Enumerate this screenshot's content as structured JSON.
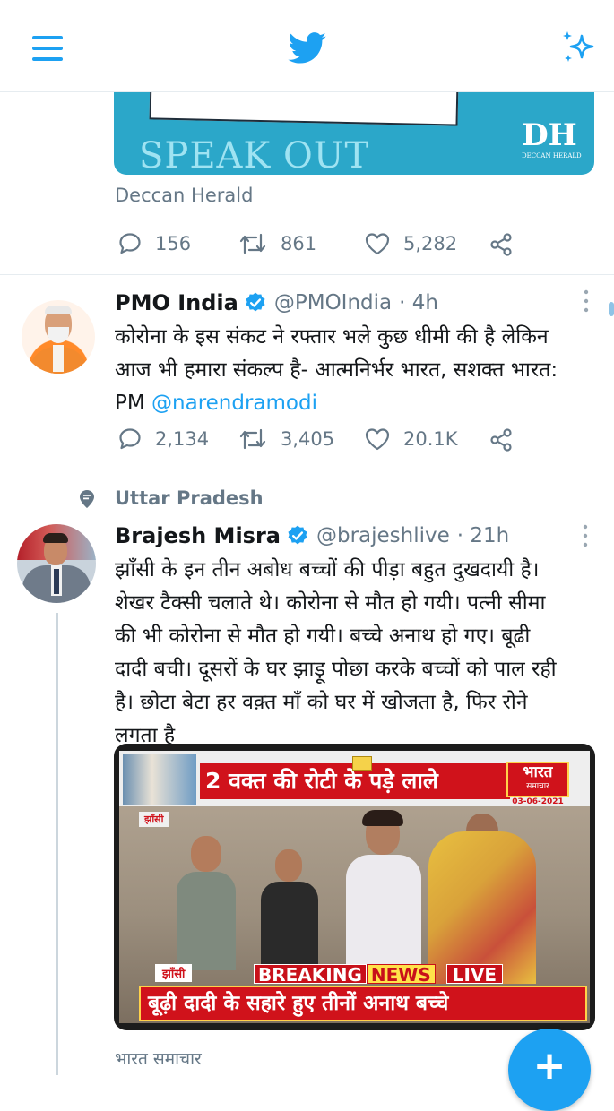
{
  "header": {
    "menu_icon": "hamburger-menu-icon",
    "logo_icon": "twitter-bird-icon",
    "sparkle_icon": "sparkle-icon"
  },
  "card1": {
    "image_text": "SPEAK OUT",
    "logo_text": "DH",
    "logo_subtext": "DECCAN HERALD",
    "source": "Deccan Herald",
    "replies": "156",
    "retweets": "861",
    "likes": "5,282"
  },
  "tweet1": {
    "name": "PMO India",
    "handle": "@PMOIndia",
    "time": "· 4h",
    "text_line1": "कोरोना के इस संकट ने रफ्तार भले कुछ धीमी की है लेकिन",
    "text_line2": "आज भी हमारा संकल्प है- आत्मनिर्भर भारत, सशक्त भारत:",
    "text_line3_prefix": "PM ",
    "mention": "@narendramodi",
    "replies": "2,134",
    "retweets": "3,405",
    "likes": "20.1K"
  },
  "tweet2": {
    "context_label": "Uttar Pradesh",
    "name": "Brajesh Misra",
    "handle": "@brajeshlive",
    "time": "· 21h",
    "lines": [
      "झाँसी के इन तीन अबोध बच्चों की पीड़ा बहुत दुखदायी है।",
      "शेखर टैक्सी चलाते थे। कोरोना से मौत हो गयी। पत्नी सीमा",
      "की भी कोरोना से मौत हो गयी। बच्चे अनाथ हो गए। बूढी",
      "दादी बची। दूसरों के घर झाड़ू पोछा करके बच्चों को पाल रही",
      "है। छोटा बेटा हर वक़्त माँ को घर में खोजता है, फिर रोने",
      "लगता है"
    ],
    "media": {
      "headline_top": "2 वक्त की रोटी के पड़े लाले",
      "channel": "भारत",
      "channel_sub": "समाचार",
      "date": "03-06-2021",
      "place_tag": "झाँसी",
      "place_tag2": "झाँसी",
      "breaking": "BREAKING",
      "news": "NEWS",
      "live": "LIVE",
      "headline_bottom": "बूढ़ी दादी के सहारे हुए तीनों अनाथ बच्चे"
    },
    "source": "भारत समाचार"
  },
  "fab": {
    "label": "+"
  },
  "colors": {
    "twitter_blue": "#1da1f2",
    "text": "#14171a",
    "secondary": "#657786",
    "speakout_bg": "#2ba7c9",
    "breaking_red": "#d0121b"
  }
}
